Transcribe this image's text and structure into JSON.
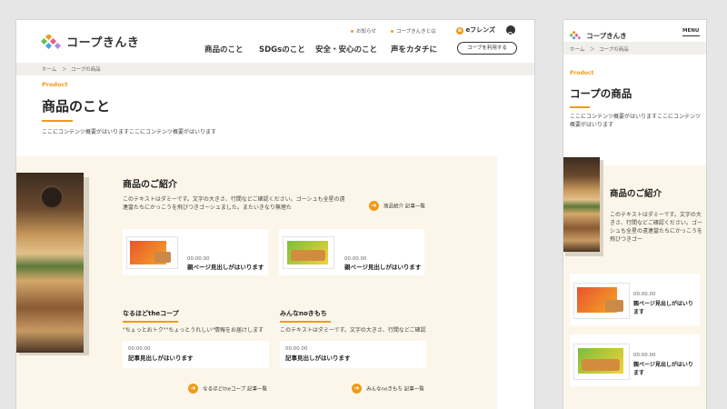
{
  "brand": {
    "name": "コープきんき",
    "friends_logo": "eフレンズ"
  },
  "colors": {
    "accent": "#f19a1a",
    "beige": "#fcf6ea",
    "crumb_bg": "#f1efeb"
  },
  "header": {
    "util_links": [
      "お知らせ",
      "コープきんきとは"
    ],
    "nav": [
      "商品のこと",
      "SDGsのこと",
      "安全・安心のこと",
      "声をカタチに"
    ],
    "cta": "コープを利用する",
    "search_icon": "search-icon"
  },
  "breadcrumb": {
    "home": "ホーム",
    "sep": "＞",
    "current": "コープの商品"
  },
  "page": {
    "eyebrow": "Prodoct",
    "title": "商品のこと",
    "lead": "ここにコンテンツ概要がはいりますここにコンテンツ概要がはいります"
  },
  "intro": {
    "heading": "商品のご紹介",
    "text": "このテキストはダミーです。文字の大きさ、行間などご確認ください。ゴーシュも全星の遠連當たちにかっこうを飛びつきゴーシュました。またいきなり無理た",
    "link": "商品紹介 記事一覧",
    "cards": [
      {
        "date": "00.00.00",
        "title": "親ページ見出しがはいります"
      },
      {
        "date": "00.00.00",
        "title": "親ページ見出しがはいります"
      }
    ]
  },
  "naruhodo": {
    "heading": "なるほどtheコープ",
    "text": "\"ちょっとおトク\"\"ちょっとうれしい\"情報をお届けします",
    "date": "00.00.00",
    "title": "記事見出しがはいります",
    "link": "なるほどtheコープ 記事一覧"
  },
  "minna": {
    "heading": "みんなnoきもち",
    "text": "このテキストはダミーです。文字の大きさ、行間などご確認",
    "date": "00.00.00",
    "title": "記事見出しがはいります",
    "link": "みんなnoきもち 記事一覧"
  },
  "mobile": {
    "menu": "MENU",
    "breadcrumb_home": "ホーム",
    "breadcrumb_sep": "＞",
    "breadcrumb_current": "コープの商品",
    "eyebrow": "Prodoct",
    "title": "コープの商品",
    "lead": "ここにコンテンツ概要がはいりますここにコンテンツ概要がはいります",
    "intro_heading": "商品のご紹介",
    "intro_text": "このテキストはダミーです。文字の大きさ、行間などご確認ください。ゴーシュも全星の遠連當たちにかっこうを飛びつきゴー",
    "cards": [
      {
        "date": "00.00.00",
        "title": "親ページ見出しがはいります"
      },
      {
        "date": "00.00.00",
        "title": "親ページ見出しがはいります"
      }
    ]
  }
}
